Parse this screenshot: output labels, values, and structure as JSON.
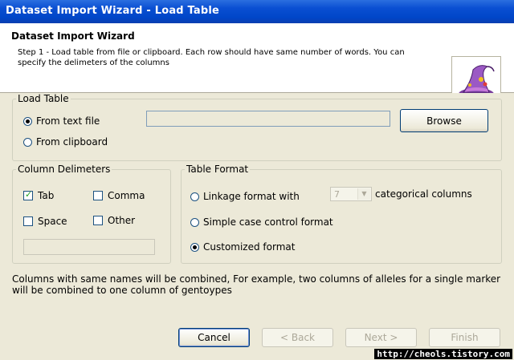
{
  "window": {
    "title": "Dataset Import Wizard - Load Table"
  },
  "header": {
    "title": "Dataset Import Wizard",
    "description": "Step 1 - Load table from file or clipboard. Each row should have same number of words. You can specify the delimeters of the columns",
    "logo_icon": "wizard-hat-icon"
  },
  "load_table": {
    "legend": "Load Table",
    "from_text_file": {
      "label": "From text file",
      "selected": true
    },
    "from_clipboard": {
      "label": "From clipboard",
      "selected": false
    },
    "file_path": "",
    "browse_label": "Browse"
  },
  "column_delimiters": {
    "legend": "Column Delimeters",
    "tab": {
      "label": "Tab",
      "checked": true
    },
    "comma": {
      "label": "Comma",
      "checked": false
    },
    "space": {
      "label": "Space",
      "checked": false
    },
    "other": {
      "label": "Other",
      "checked": false
    },
    "other_value": ""
  },
  "table_format": {
    "legend": "Table Format",
    "linkage": {
      "label": "Linkage format with",
      "selected": false
    },
    "categorical_count": "7",
    "categorical_suffix": "categorical columns",
    "simple_case_control": {
      "label": "Simple case control format",
      "selected": false
    },
    "customized": {
      "label": "Customized format",
      "selected": true
    }
  },
  "note": "Columns with same names will be combined, For example, two columns of alleles for a single marker will be combined to one column of gentoypes",
  "buttons": {
    "cancel": "Cancel",
    "back": "< Back",
    "next": "Next >",
    "finish": "Finish"
  },
  "watermark": "http://cheols.tistory.com",
  "colors": {
    "title_bar": "#0a4fd2",
    "dialog_bg": "#ece9d8",
    "header_bg": "#ffffff"
  }
}
